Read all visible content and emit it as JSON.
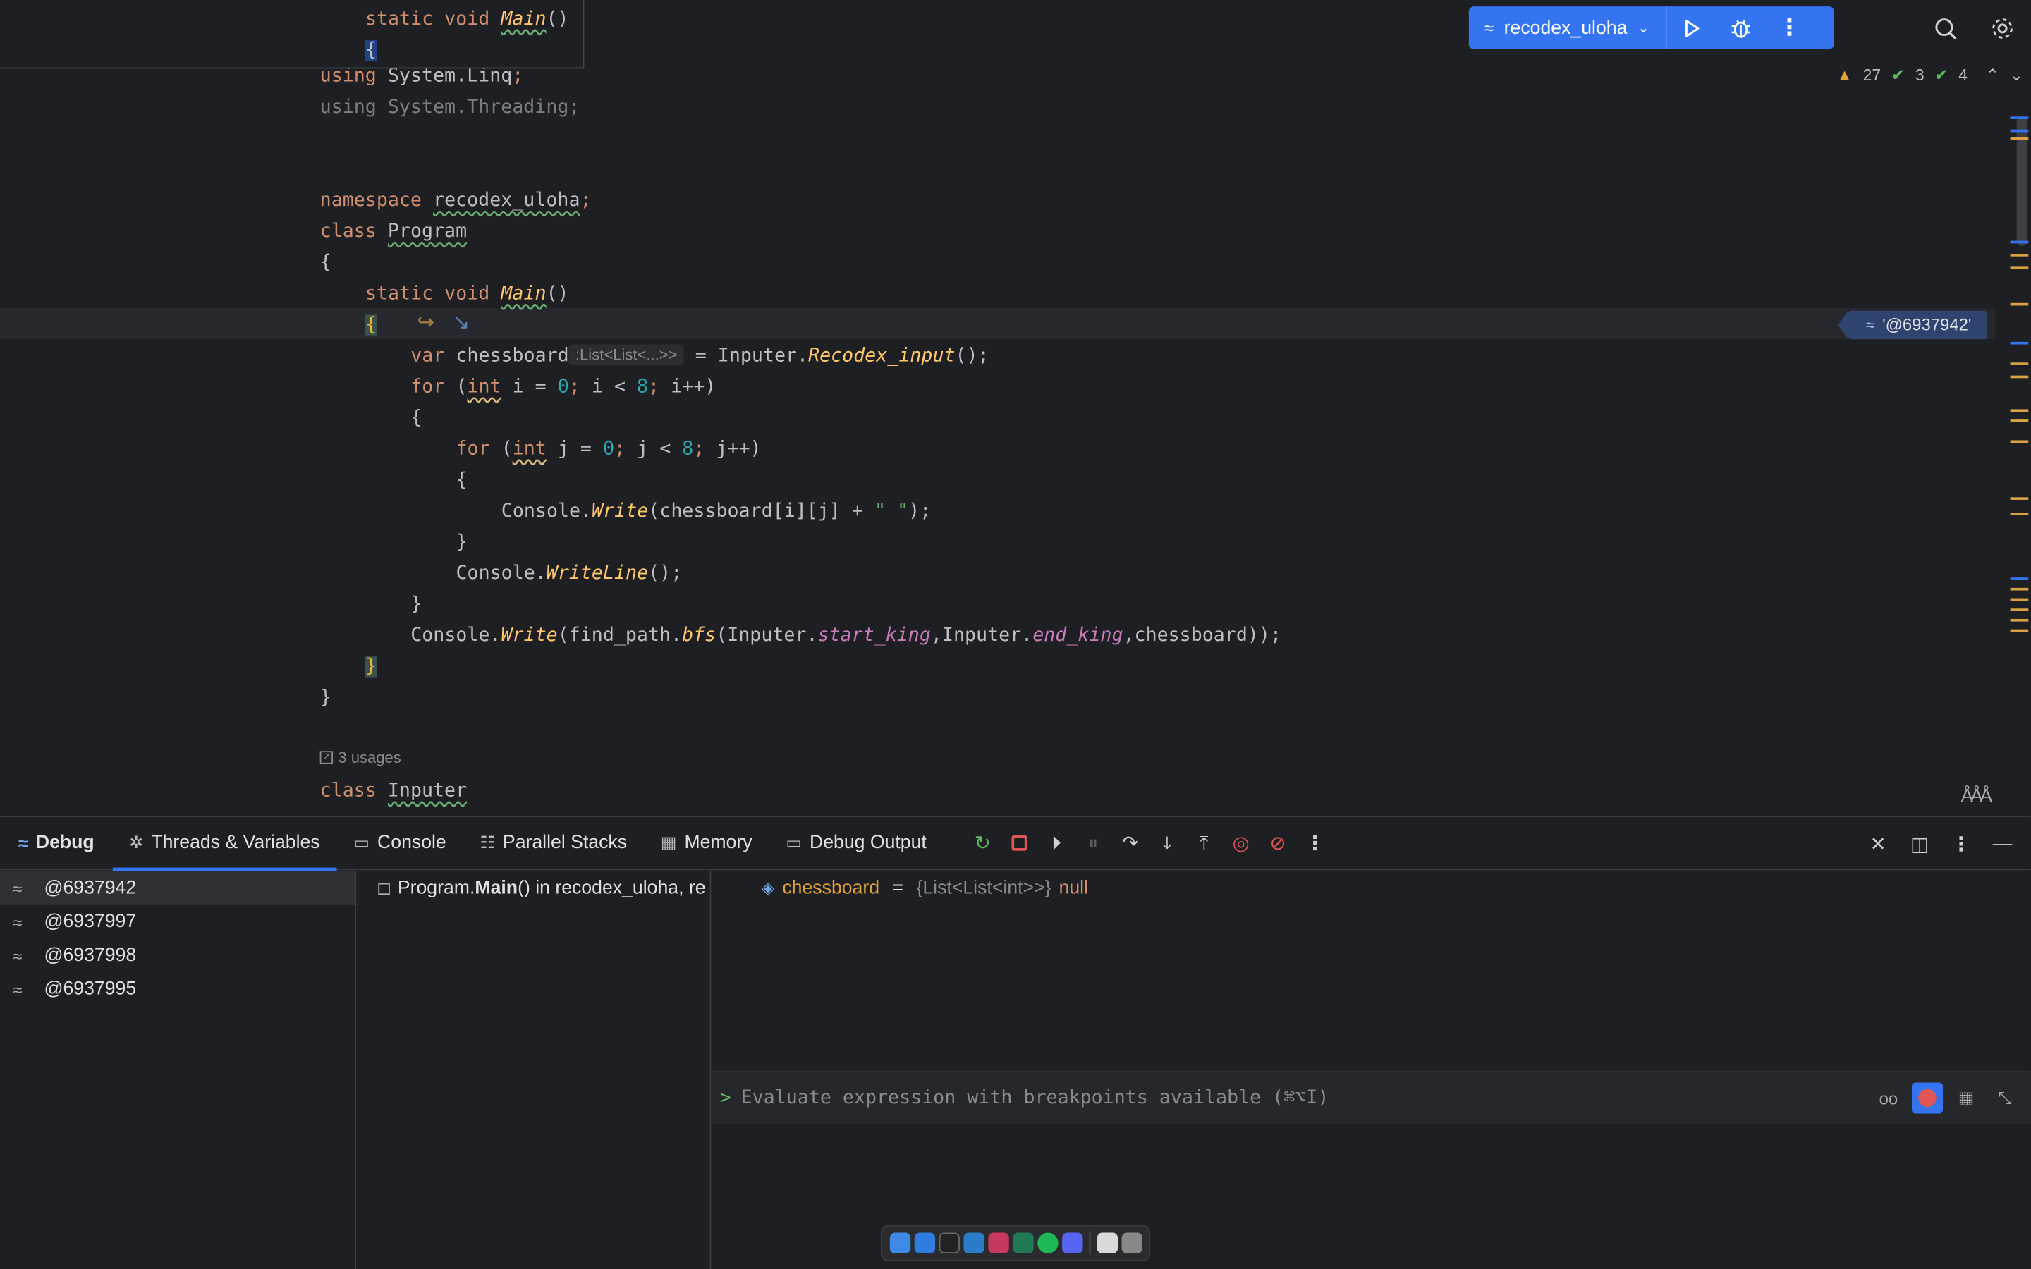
{
  "editor": {
    "sticky": {
      "line1_kw": "static void ",
      "line1_fn": "Main",
      "line1_rest": "()",
      "line2": "{"
    },
    "lines": {
      "l1_kw": "using ",
      "l1_rest": "System.Linq",
      "l1_semi": ";",
      "l2": "using System.Threading;",
      "l3_kw": "namespace ",
      "l3_name": "recodex_uloha",
      "l3_semi": ";",
      "l4_kw": "class ",
      "l4_name": "Program",
      "l5": "{",
      "l6_kw": "static void ",
      "l6_fn": "Main",
      "l6_rest": "()",
      "l7": "{",
      "l8_kw": "var ",
      "l8_name": "chessboard",
      "l8_hint": ":List<List<...>>",
      "l8_eq": " = Inputer.",
      "l8_fn": "Recodex_input",
      "l8_rest": "();",
      "l9": "for (int i = 0; i < 8; i++)",
      "l10": "{",
      "l11": "for (int j = 0; j < 8; j++)",
      "l12": "{",
      "l13_a": "Console.",
      "l13_fn": "Write",
      "l13_b": "(chessboard[i][j] + ",
      "l13_str": "\" \"",
      "l13_c": ");",
      "l14": "}",
      "l15_a": "Console.",
      "l15_fn": "WriteLine",
      "l15_b": "();",
      "l16": "}",
      "l17_a": "Console.",
      "l17_fn": "Write",
      "l17_b": "(find_path.",
      "l17_fn2": "bfs",
      "l17_c": "(Inputer.",
      "l17_st1": "start_king",
      "l17_d": ",Inputer.",
      "l17_st2": "end_king",
      "l17_e": ",chessboard));",
      "l18": "}",
      "l19": "}",
      "l20_kw": "class ",
      "l20_name": "Inputer"
    },
    "usages": "3 usages",
    "inline_value": "'@6937942'",
    "inspections": {
      "warnings": "27",
      "checks": "3",
      "typos": "4"
    }
  },
  "toolbar": {
    "run_config": "recodex_uloha",
    "icons": [
      "run-icon",
      "debug-icon",
      "more-icon",
      "search-icon",
      "gear-icon"
    ]
  },
  "debug": {
    "title": "Debug",
    "tabs": [
      {
        "label": "Threads & Variables",
        "icon": "bug-icon"
      },
      {
        "label": "Console",
        "icon": "console-icon"
      },
      {
        "label": "Parallel Stacks",
        "icon": "stacks-icon"
      },
      {
        "label": "Memory",
        "icon": "memory-icon"
      },
      {
        "label": "Debug Output",
        "icon": "output-icon"
      }
    ],
    "threads": [
      "@6937942",
      "@6937997",
      "@6937998",
      "@6937995"
    ],
    "frames": [
      {
        "prefix": "Program.",
        "method": "Main",
        "suffix": "() in recodex_uloha, re"
      }
    ],
    "variables": [
      {
        "name": "chessboard",
        "eq": " = ",
        "type": "{List<List<int>>}",
        "value": "null"
      }
    ],
    "evaluate": {
      "prompt": ">",
      "placeholder": "Evaluate expression with breakpoints available (⌘⌥I)"
    }
  },
  "colors": {
    "accent": "#3574f0",
    "background": "#1e1f22",
    "warning": "#e0a33e",
    "stop": "#e05555"
  }
}
